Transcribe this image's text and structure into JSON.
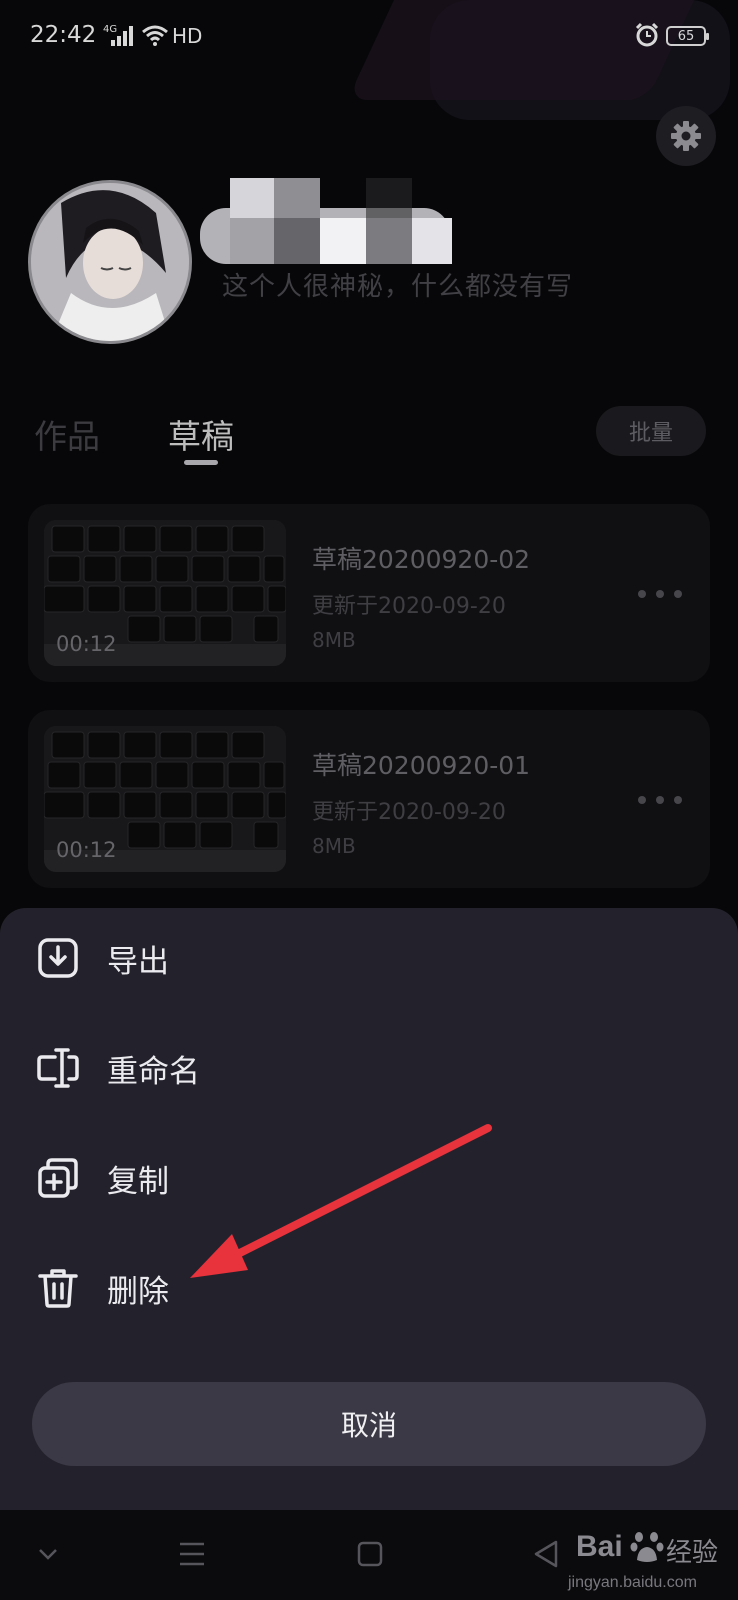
{
  "status_bar": {
    "time": "22:42",
    "network": "4G",
    "hd": "HD",
    "battery": "65"
  },
  "profile": {
    "bio": "这个人很神秘，什么都没有写"
  },
  "tabs": [
    {
      "label": "作品",
      "active": false
    },
    {
      "label": "草稿",
      "active": true
    }
  ],
  "batch_label": "批量",
  "drafts": [
    {
      "duration": "00:12",
      "title": "草稿20200920-02",
      "updated": "更新于2020-09-20",
      "size": "8MB"
    },
    {
      "duration": "00:12",
      "title": "草稿20200920-01",
      "updated": "更新于2020-09-20",
      "size": "8MB"
    }
  ],
  "sheet": {
    "items": [
      {
        "label": "导出",
        "icon": "export-icon"
      },
      {
        "label": "重命名",
        "icon": "rename-icon"
      },
      {
        "label": "复制",
        "icon": "copy-icon"
      },
      {
        "label": "删除",
        "icon": "delete-icon"
      }
    ],
    "cancel": "取消"
  },
  "watermark": {
    "brand": "Bai",
    "brand_cn": "经验",
    "url": "jingyan.baidu.com"
  },
  "colors": {
    "background": "#070709",
    "sheet": "#23222c",
    "cancel_button": "#3a3945",
    "annotation_arrow": "#e8323c"
  }
}
